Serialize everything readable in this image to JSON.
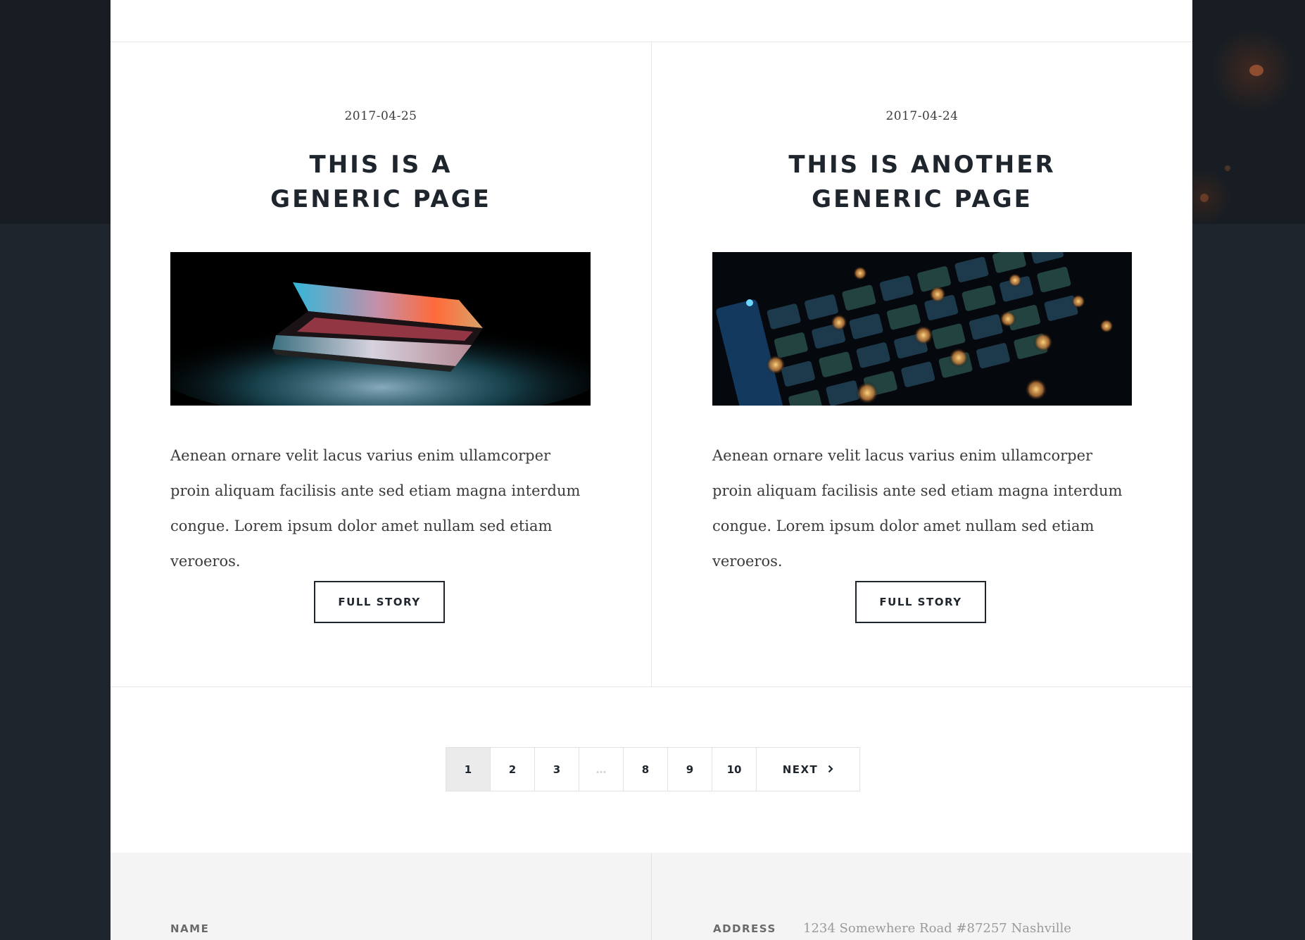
{
  "posts": [
    {
      "date": "2017-04-25",
      "title_line1": "THIS IS A",
      "title_line2": "GENERIC PAGE",
      "text": "Aenean ornare velit lacus varius enim ullamcorper proin aliquam facilisis ante sed etiam magna interdum congue. Lorem ipsum dolor amet nullam sed etiam veroeros.",
      "button_label": "FULL STORY"
    },
    {
      "date": "2017-04-24",
      "title_line1": "THIS IS ANOTHER",
      "title_line2": "GENERIC PAGE",
      "text": "Aenean ornare velit lacus varius enim ullamcorper proin aliquam facilisis ante sed etiam magna interdum congue. Lorem ipsum dolor amet nullam sed etiam veroeros.",
      "button_label": "FULL STORY"
    }
  ],
  "pagination": {
    "pages": [
      "1",
      "2",
      "3",
      "…",
      "8",
      "9",
      "10"
    ],
    "current_page": "1",
    "next_label": "NEXT",
    "next_icon": "chevron-right-icon"
  },
  "footer": {
    "name_label": "NAME",
    "address_label": "ADDRESS",
    "address_value": "1234 Somewhere Road #87257 Nashville"
  },
  "colors": {
    "page_background": "#1e252d",
    "heading": "#1f252d",
    "body_text": "#3c3b3b",
    "active_page": "#ebebeb",
    "footer_background": "#f4f4f4"
  }
}
